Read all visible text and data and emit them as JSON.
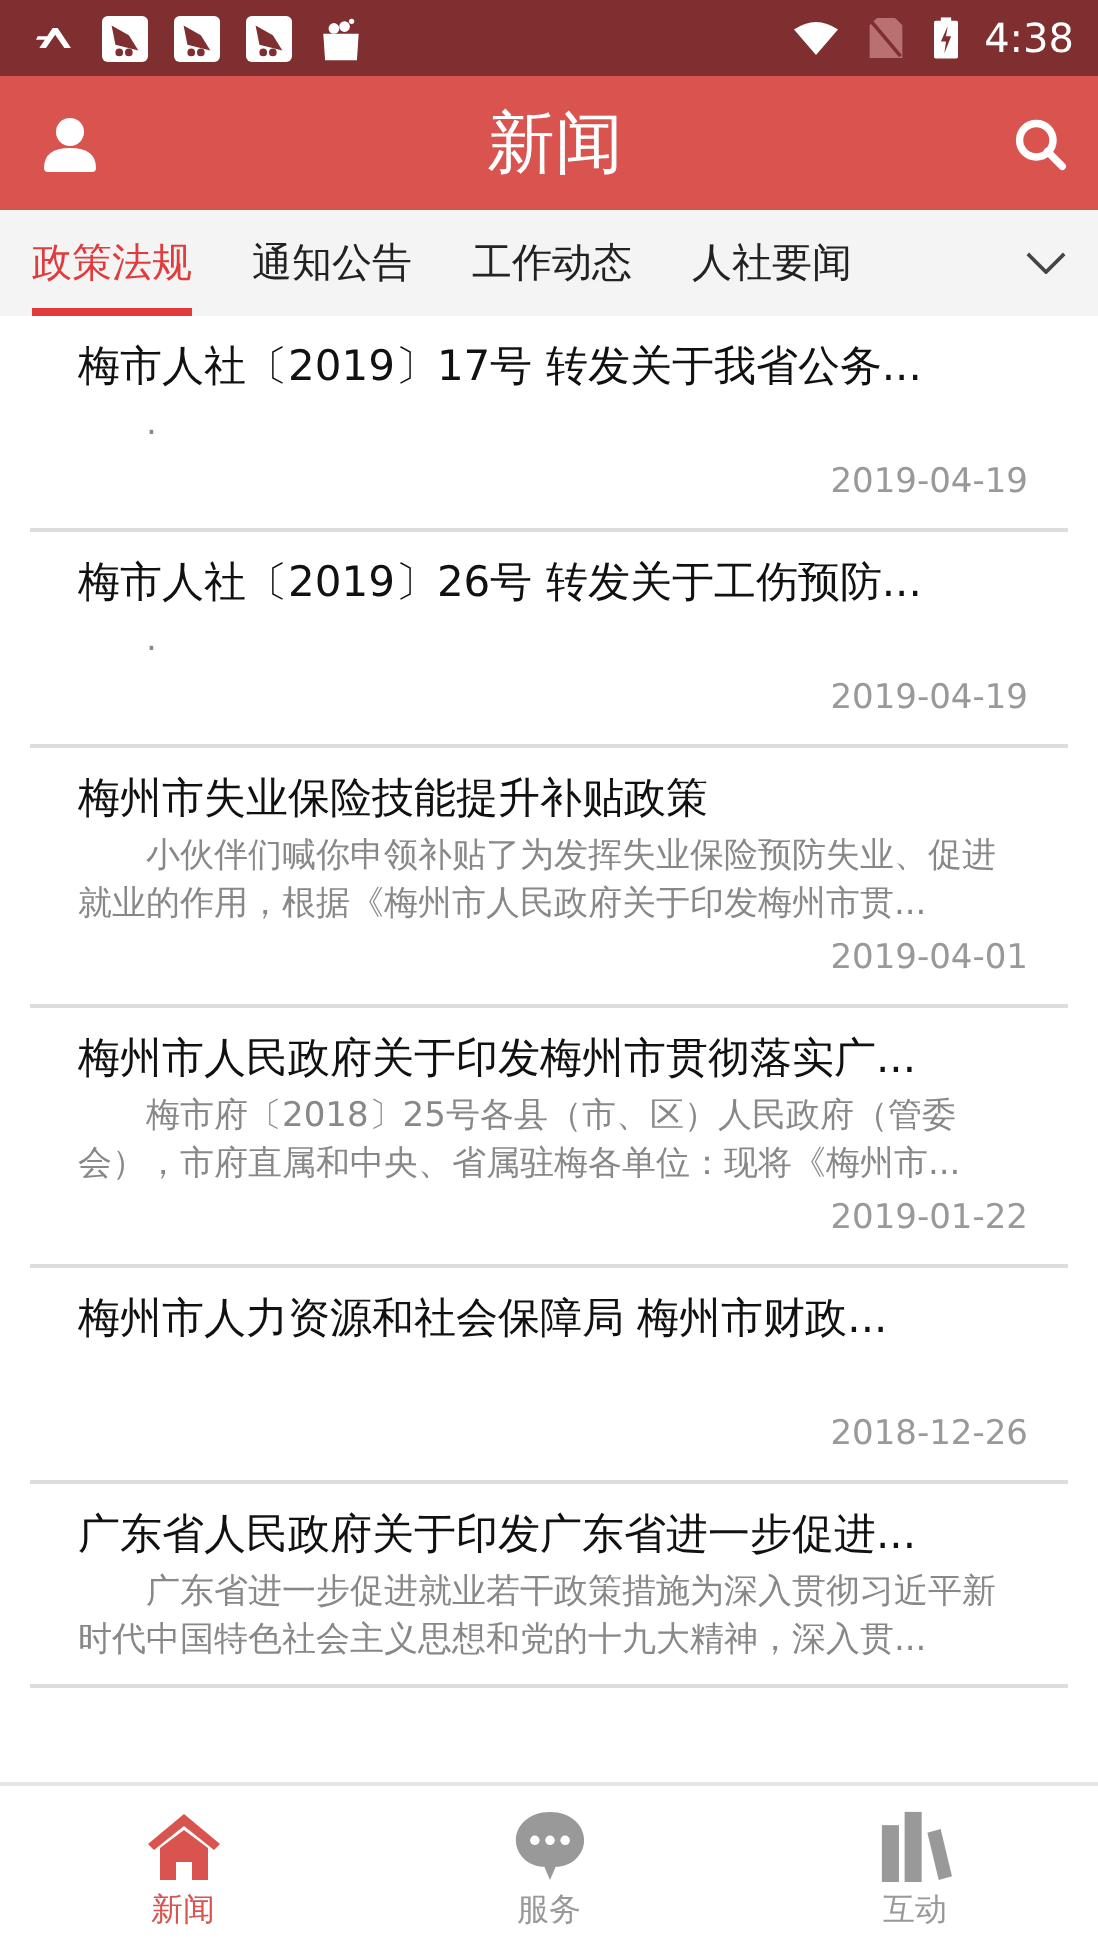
{
  "status_bar": {
    "time": "4:38"
  },
  "header": {
    "title": "新闻"
  },
  "tabs": [
    {
      "label": "政策法规",
      "selected": true
    },
    {
      "label": "通知公告",
      "selected": false
    },
    {
      "label": "工作动态",
      "selected": false
    },
    {
      "label": "人社要闻",
      "selected": false
    }
  ],
  "news": [
    {
      "title": "梅市人社〔2019〕17号 转发关于我省公务...",
      "summary": ".",
      "date": "2019-04-19"
    },
    {
      "title": "梅市人社〔2019〕26号 转发关于工伤预防...",
      "summary": ".",
      "date": "2019-04-19"
    },
    {
      "title": "梅州市失业保险技能提升补贴政策",
      "summary": "小伙伴们喊你申领补贴了为发挥失业保险预防失业、促进就业的作用，根据《梅州市人民政府关于印发梅州市贯...",
      "date": "2019-04-01"
    },
    {
      "title": "梅州市人民政府关于印发梅州市贯彻落实广...",
      "summary": "梅市府〔2018〕25号各县（市、区）人民政府（管委会），市府直属和中央、省属驻梅各单位：现将《梅州市...",
      "date": "2019-01-22"
    },
    {
      "title": "梅州市人力资源和社会保障局 梅州市财政...",
      "date": "2018-12-26"
    },
    {
      "title": "广东省人民政府关于印发广东省进一步促进...",
      "summary": "广东省进一步促进就业若干政策措施为深入贯彻习近平新时代中国特色社会主义思想和党的十九大精神，深入贯..."
    }
  ],
  "bottom_nav": [
    {
      "kind": "home",
      "label": "新闻",
      "selected": true
    },
    {
      "kind": "chat",
      "label": "服务",
      "selected": false
    },
    {
      "kind": "books",
      "label": "互动",
      "selected": false
    }
  ]
}
